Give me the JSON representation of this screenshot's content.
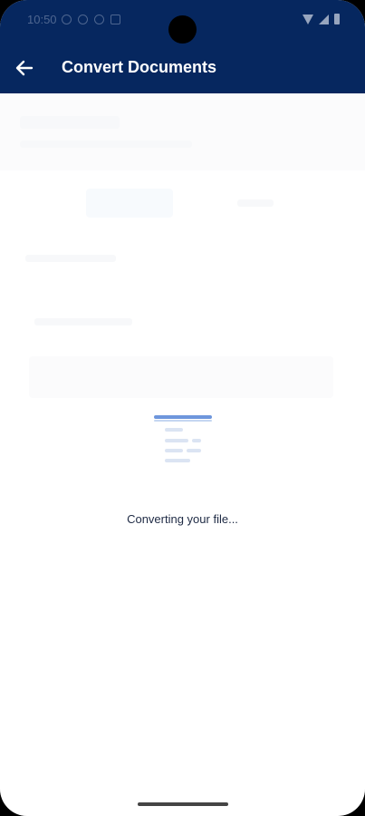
{
  "status_bar": {
    "time": "10:50"
  },
  "app_bar": {
    "title": "Convert Documents",
    "back_icon": "arrow-left-icon"
  },
  "loading": {
    "message": "Converting your file...",
    "icon": "document-lines-icon"
  },
  "colors": {
    "header": "#06275f",
    "accent": "#3f6fd1",
    "loader_lines": "#dbe4f3",
    "text": "#1e2a44"
  }
}
